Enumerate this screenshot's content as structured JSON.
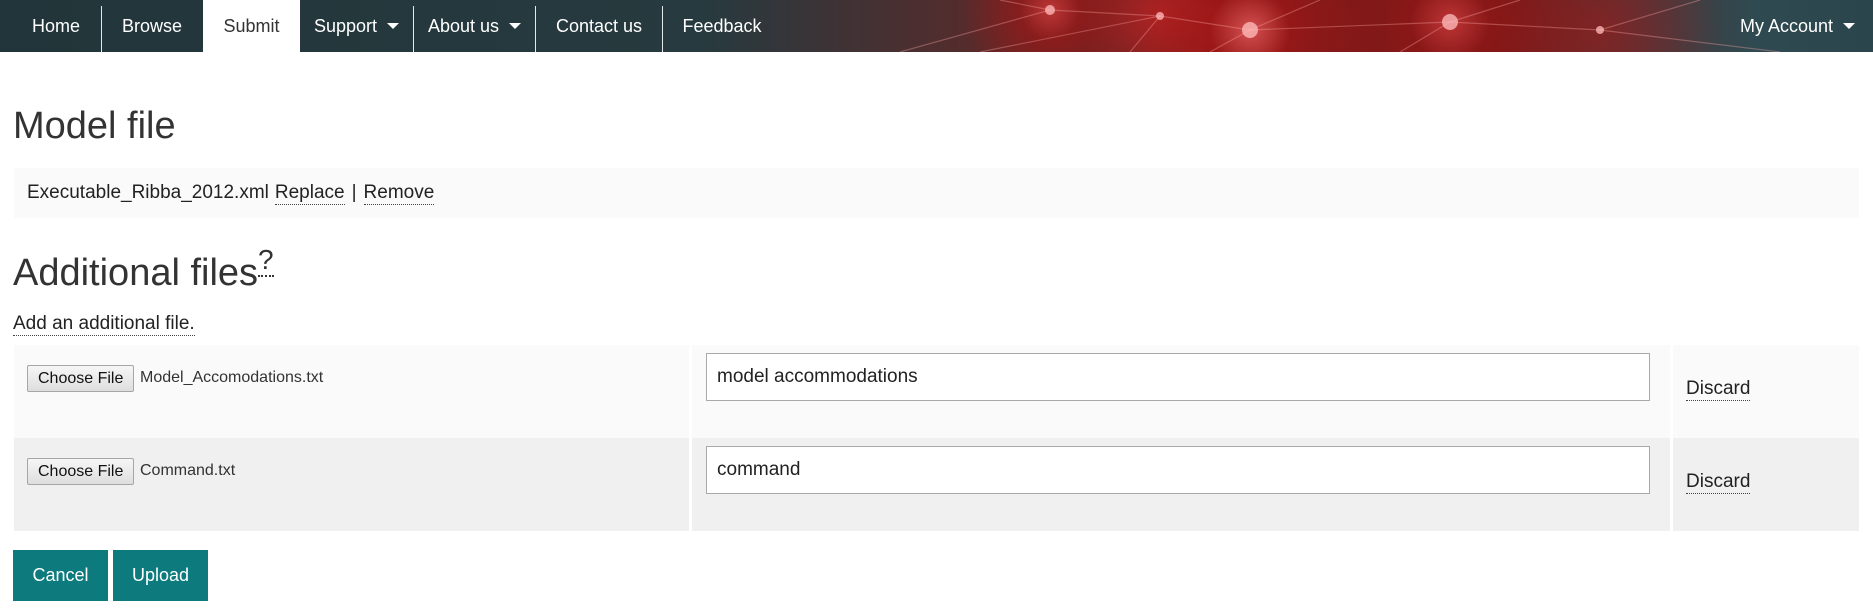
{
  "nav": {
    "items": [
      {
        "label": "Home"
      },
      {
        "label": "Browse"
      },
      {
        "label": "Submit"
      },
      {
        "label": "Support"
      },
      {
        "label": "About us"
      },
      {
        "label": "Contact us"
      },
      {
        "label": "Feedback"
      }
    ],
    "active": "Submit",
    "account": "My Account"
  },
  "model_file": {
    "heading": "Model file",
    "filename": "Executable_Ribba_2012.xml",
    "replace_label": "Replace",
    "separator": "|",
    "remove_label": "Remove"
  },
  "additional_files": {
    "heading": "Additional files",
    "help": "?",
    "add_link": "Add an additional file.",
    "rows": [
      {
        "choose_label": "Choose File",
        "filename": "Model_Accomodations.txt",
        "description": "model accommodations",
        "discard_label": "Discard"
      },
      {
        "choose_label": "Choose File",
        "filename": "Command.txt",
        "description": "command",
        "discard_label": "Discard"
      }
    ]
  },
  "actions": {
    "cancel_label": "Cancel",
    "upload_label": "Upload"
  },
  "colors": {
    "nav_bg": "#2a3a3e",
    "accent_red": "#7a1c1c",
    "button_teal": "#0d7a7e"
  }
}
